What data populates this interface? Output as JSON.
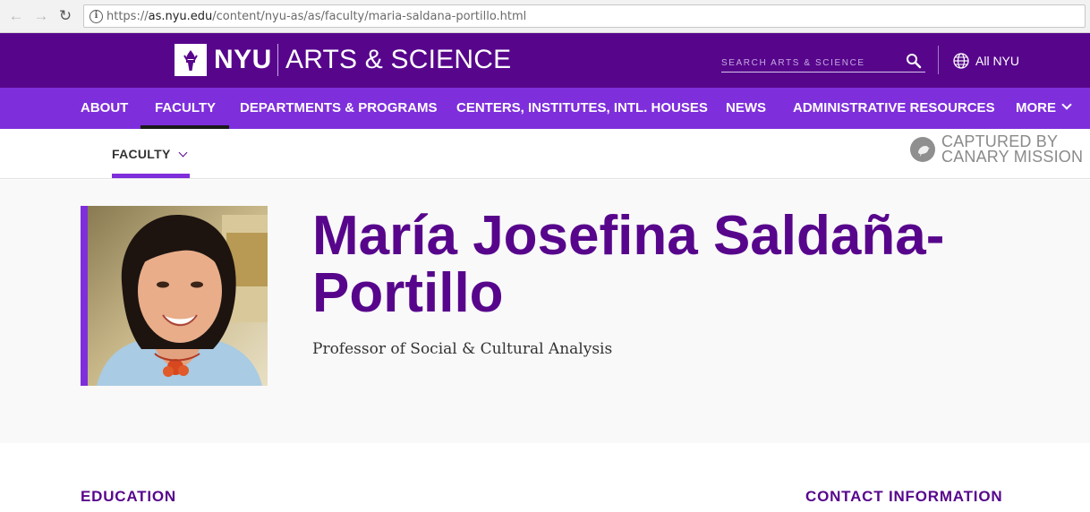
{
  "browser": {
    "url_domain": "as.nyu.edu",
    "url_prefix": "https://",
    "url_path": "/content/nyu-as/as/faculty/maria-saldana-portillo.html"
  },
  "header": {
    "logo_nyu": "NYU",
    "logo_school": "ARTS & SCIENCE",
    "search_placeholder": "SEARCH ARTS & SCIENCE",
    "all_nyu": "All NYU"
  },
  "nav": {
    "items": [
      {
        "label": "ABOUT"
      },
      {
        "label": "FACULTY"
      },
      {
        "label": "DEPARTMENTS & PROGRAMS"
      },
      {
        "label": "CENTERS, INSTITUTES, INTL. HOUSES"
      },
      {
        "label": "NEWS"
      },
      {
        "label": "ADMINISTRATIVE RESOURCES"
      },
      {
        "label": "MORE"
      }
    ],
    "active": "FACULTY"
  },
  "subnav": {
    "label": "FACULTY"
  },
  "stamp": {
    "line1": "CAPTURED BY",
    "line2": "CANARY MISSION"
  },
  "profile": {
    "name": "María Josefina Saldaña-Portillo",
    "title": "Professor of Social & Cultural Analysis"
  },
  "sections": {
    "education": "EDUCATION",
    "contact": "CONTACT INFORMATION"
  },
  "colors": {
    "nyu_purple": "#57068c",
    "nav_purple": "#7e2fdb"
  }
}
